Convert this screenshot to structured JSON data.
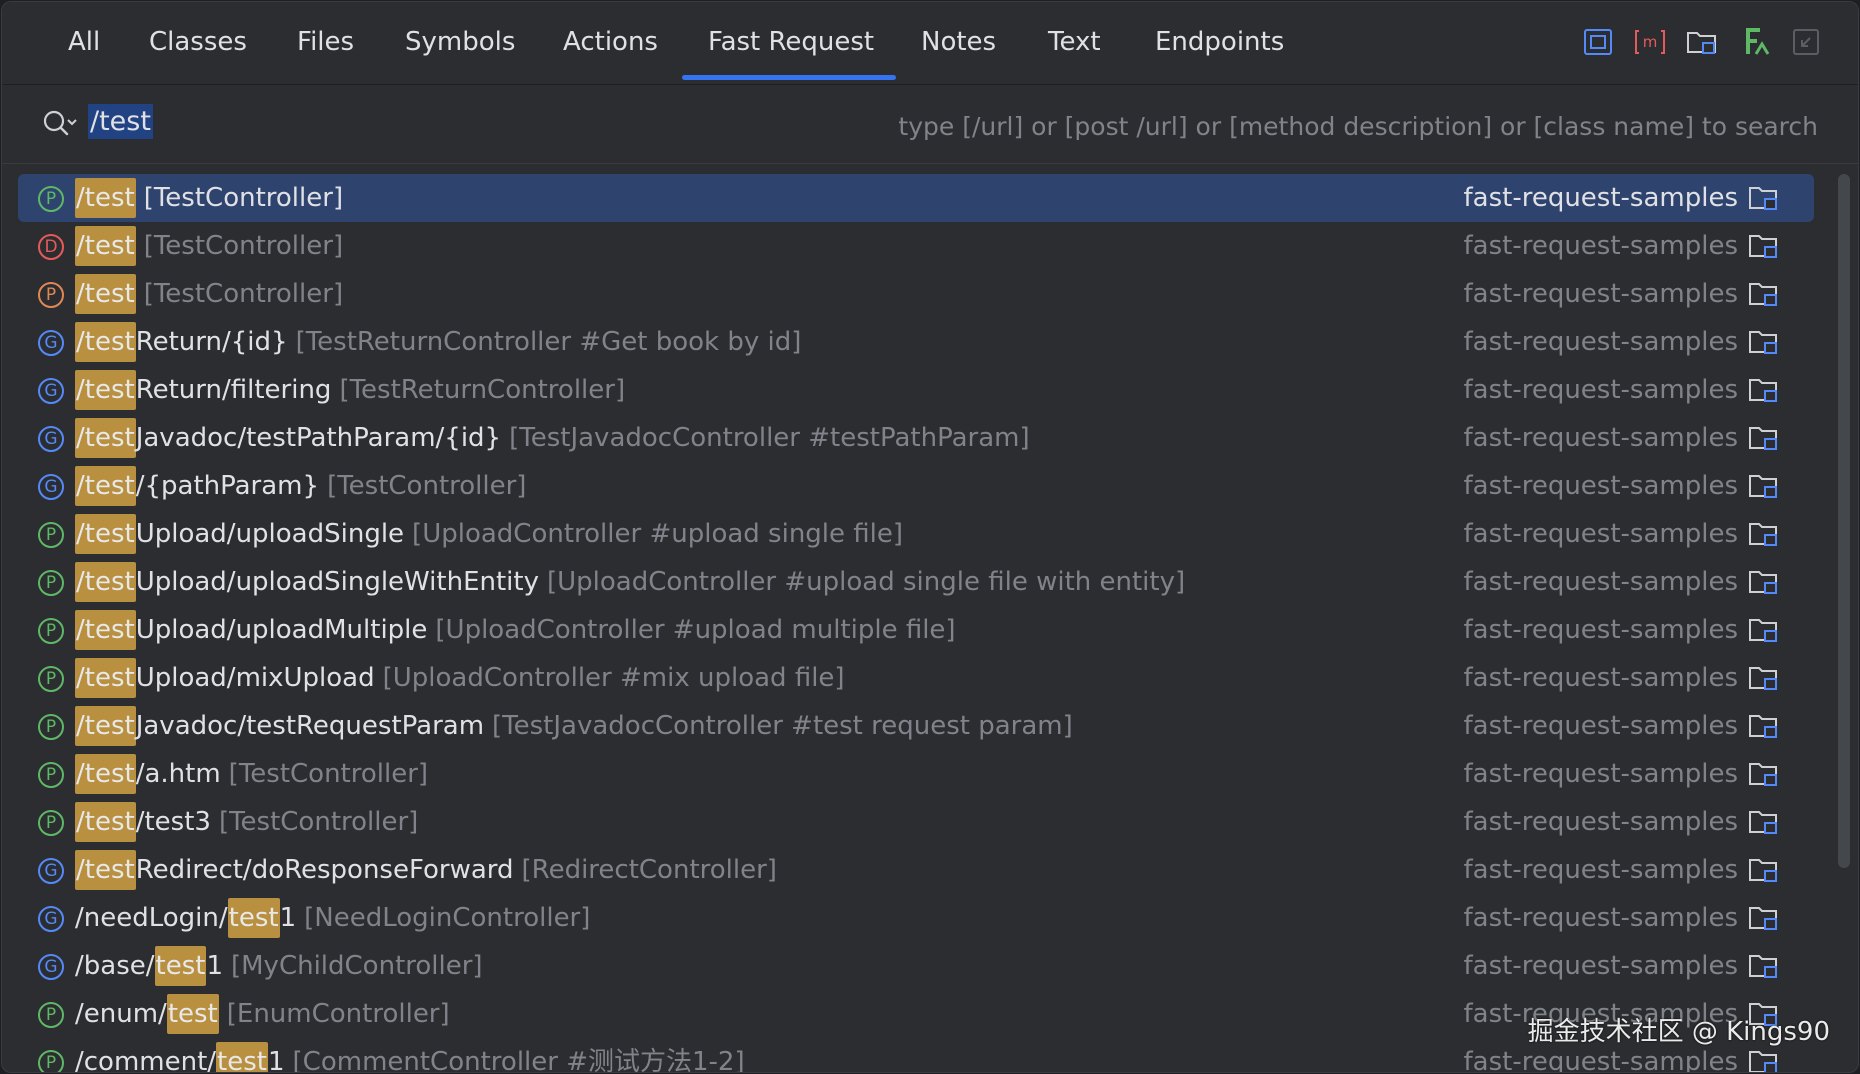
{
  "tabs": [
    {
      "label": "All",
      "active": false
    },
    {
      "label": "Classes",
      "active": false
    },
    {
      "label": "Files",
      "active": false
    },
    {
      "label": "Symbols",
      "active": false
    },
    {
      "label": "Actions",
      "active": false
    },
    {
      "label": "Fast Request",
      "active": true
    },
    {
      "label": "Notes",
      "active": false
    },
    {
      "label": "Text",
      "active": false
    },
    {
      "label": "Endpoints",
      "active": false
    }
  ],
  "toolbar_icons": [
    "frame-icon",
    "method-icon",
    "module-folder-icon",
    "fast-request-icon",
    "collapse-icon"
  ],
  "search": {
    "value": "/test",
    "hint": "type [/url] or [post /url] or [method description] or [class name] to search"
  },
  "results": [
    {
      "method": "P",
      "pre": "",
      "match": "/test",
      "post": "",
      "context": "[TestController]",
      "module": "fast-request-samples",
      "selected": true
    },
    {
      "method": "D",
      "pre": "",
      "match": "/test",
      "post": "",
      "context": "[TestController]",
      "module": "fast-request-samples"
    },
    {
      "method": "P",
      "pre": "",
      "match": "/test",
      "post": "",
      "context": "[TestController]",
      "module": "fast-request-samples",
      "alt": true
    },
    {
      "method": "G",
      "pre": "",
      "match": "/test",
      "post": "Return/{id}",
      "context": "[TestReturnController #Get book by id]",
      "module": "fast-request-samples"
    },
    {
      "method": "G",
      "pre": "",
      "match": "/test",
      "post": "Return/filtering",
      "context": "[TestReturnController]",
      "module": "fast-request-samples"
    },
    {
      "method": "G",
      "pre": "",
      "match": "/test",
      "post": "Javadoc/testPathParam/{id}",
      "context": "[TestJavadocController #testPathParam]",
      "module": "fast-request-samples"
    },
    {
      "method": "G",
      "pre": "",
      "match": "/test",
      "post": "/{pathParam}",
      "context": "[TestController]",
      "module": "fast-request-samples"
    },
    {
      "method": "P",
      "pre": "",
      "match": "/test",
      "post": "Upload/uploadSingle",
      "context": "[UploadController #upload single file]",
      "module": "fast-request-samples"
    },
    {
      "method": "P",
      "pre": "",
      "match": "/test",
      "post": "Upload/uploadSingleWithEntity",
      "context": "[UploadController #upload single file with entity]",
      "module": "fast-request-samples"
    },
    {
      "method": "P",
      "pre": "",
      "match": "/test",
      "post": "Upload/uploadMultiple",
      "context": "[UploadController #upload multiple file]",
      "module": "fast-request-samples"
    },
    {
      "method": "P",
      "pre": "",
      "match": "/test",
      "post": "Upload/mixUpload",
      "context": "[UploadController #mix upload file]",
      "module": "fast-request-samples"
    },
    {
      "method": "P",
      "pre": "",
      "match": "/test",
      "post": "Javadoc/testRequestParam",
      "context": "[TestJavadocController #test request param]",
      "module": "fast-request-samples"
    },
    {
      "method": "P",
      "pre": "",
      "match": "/test",
      "post": "/a.htm",
      "context": "[TestController]",
      "module": "fast-request-samples"
    },
    {
      "method": "P",
      "pre": "",
      "match": "/test",
      "post": "/test3",
      "context": "[TestController]",
      "module": "fast-request-samples"
    },
    {
      "method": "G",
      "pre": "",
      "match": "/test",
      "post": "Redirect/doResponseForward",
      "context": "[RedirectController]",
      "module": "fast-request-samples"
    },
    {
      "method": "G",
      "pre": "/needLogin/",
      "match": "test",
      "post": "1",
      "context": "[NeedLoginController]",
      "module": "fast-request-samples"
    },
    {
      "method": "G",
      "pre": "/base/",
      "match": "test",
      "post": "1",
      "context": "[MyChildController]",
      "module": "fast-request-samples"
    },
    {
      "method": "P",
      "pre": "/enum/",
      "match": "test",
      "post": "",
      "context": "[EnumController]",
      "module": "fast-request-samples"
    },
    {
      "method": "P",
      "pre": "/comment/",
      "match": "test",
      "post": "1",
      "context": "[CommentController #测试方法1-2]",
      "module": "fast-request-samples"
    }
  ],
  "watermark": "掘金技术社区 @ Kings90",
  "colors": {
    "accent": "#3574f0",
    "selection": "#2e436e",
    "post": "#5fb865",
    "delete": "#e55b5b",
    "get": "#548af7",
    "highlight": "#b8903f"
  }
}
